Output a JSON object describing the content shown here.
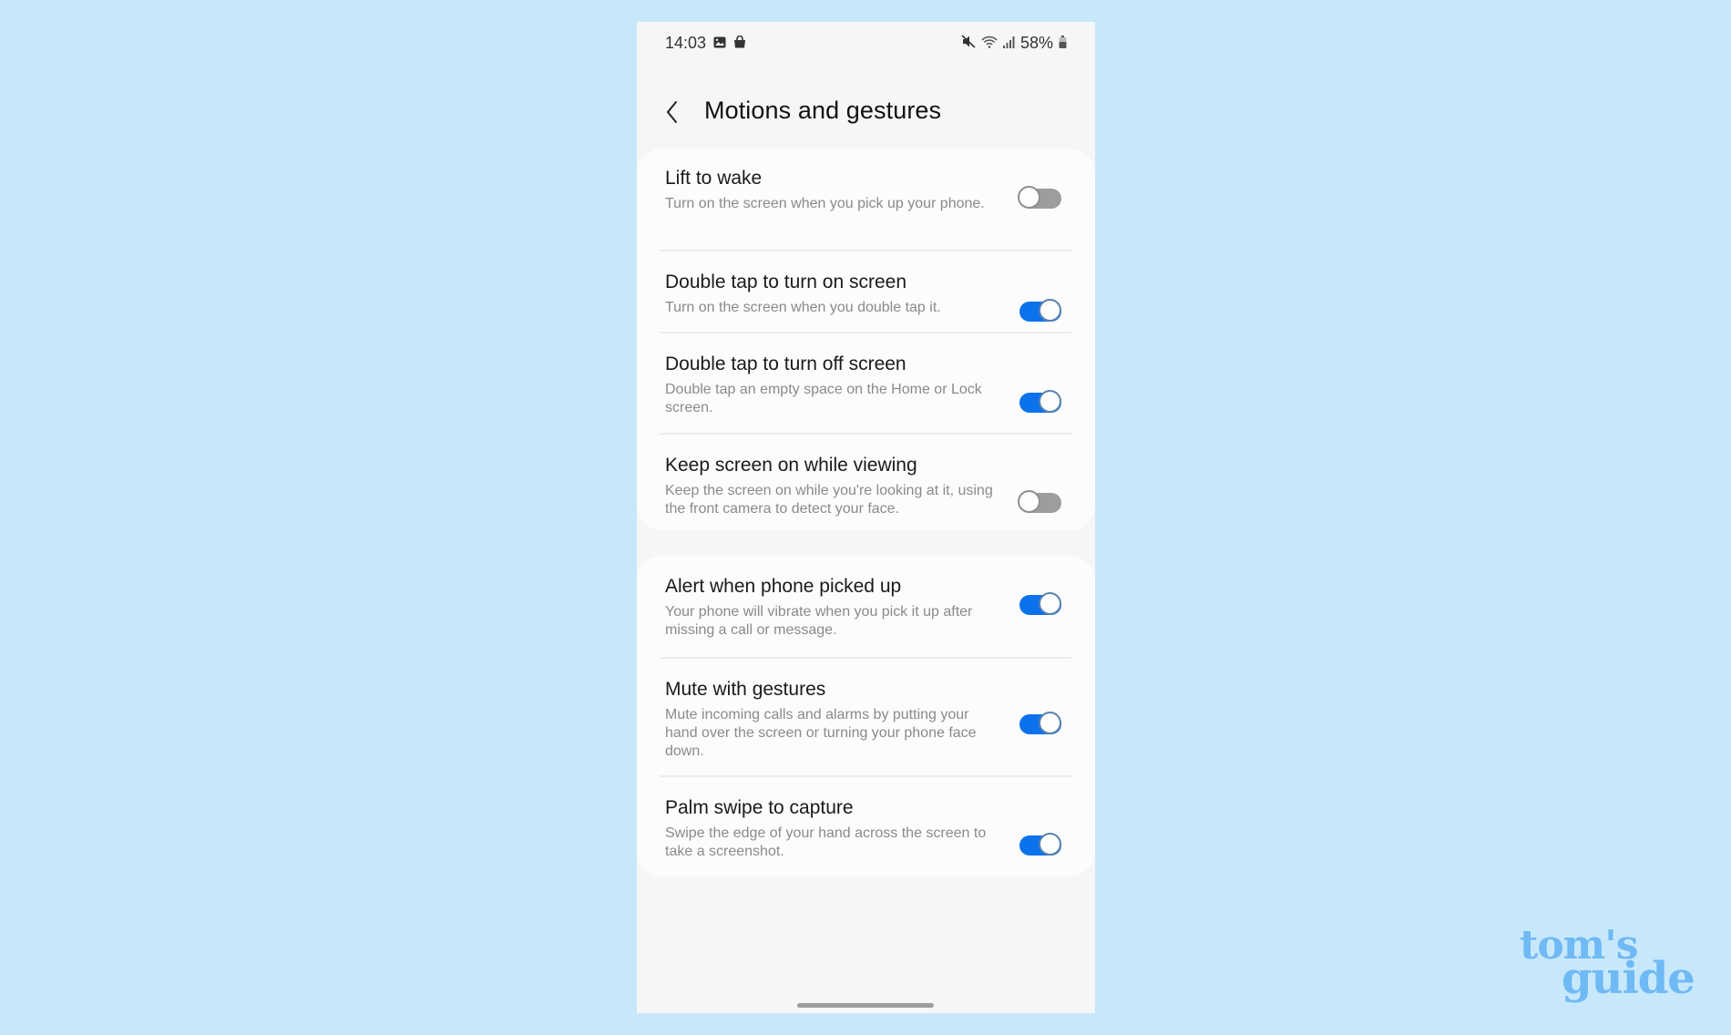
{
  "status_bar": {
    "time": "14:03",
    "left_icons": [
      "gallery-icon",
      "shopping-bag-icon"
    ],
    "right_icons": [
      "mute-icon",
      "wifi-icon",
      "signal-icon"
    ],
    "battery": "58%"
  },
  "header": {
    "back_icon": "chevron-left-icon",
    "title": "Motions and gestures"
  },
  "groups": [
    {
      "items": [
        {
          "title": "Lift to wake",
          "description": "Turn on the screen when you pick up your phone.",
          "enabled": false
        },
        {
          "title": "Double tap to turn on screen",
          "description": "Turn on the screen when you double tap it.",
          "enabled": true
        },
        {
          "title": "Double tap to turn off screen",
          "description": "Double tap an empty space on the Home or Lock screen.",
          "enabled": true
        },
        {
          "title": "Keep screen on while viewing",
          "description": "Keep the screen on while you're looking at it, using the front camera to detect your face.",
          "enabled": false
        }
      ]
    },
    {
      "items": [
        {
          "title": "Alert when phone picked up",
          "description": "Your phone will vibrate when you pick it up after missing a call or message.",
          "enabled": true
        },
        {
          "title": "Mute with gestures",
          "description": "Mute incoming calls and alarms by putting your hand over the screen or turning your phone face down.",
          "enabled": true
        },
        {
          "title": "Palm swipe to capture",
          "description": "Swipe the edge of your hand across the screen to take a screenshot.",
          "enabled": true
        }
      ]
    }
  ],
  "colors": {
    "background": "#c7e8fb",
    "toggle_on": "#0b72ec",
    "toggle_off": "#9d9d9d",
    "logo": "#6fb9f4"
  },
  "watermark": {
    "line1": "tom's",
    "line2": "guide"
  }
}
